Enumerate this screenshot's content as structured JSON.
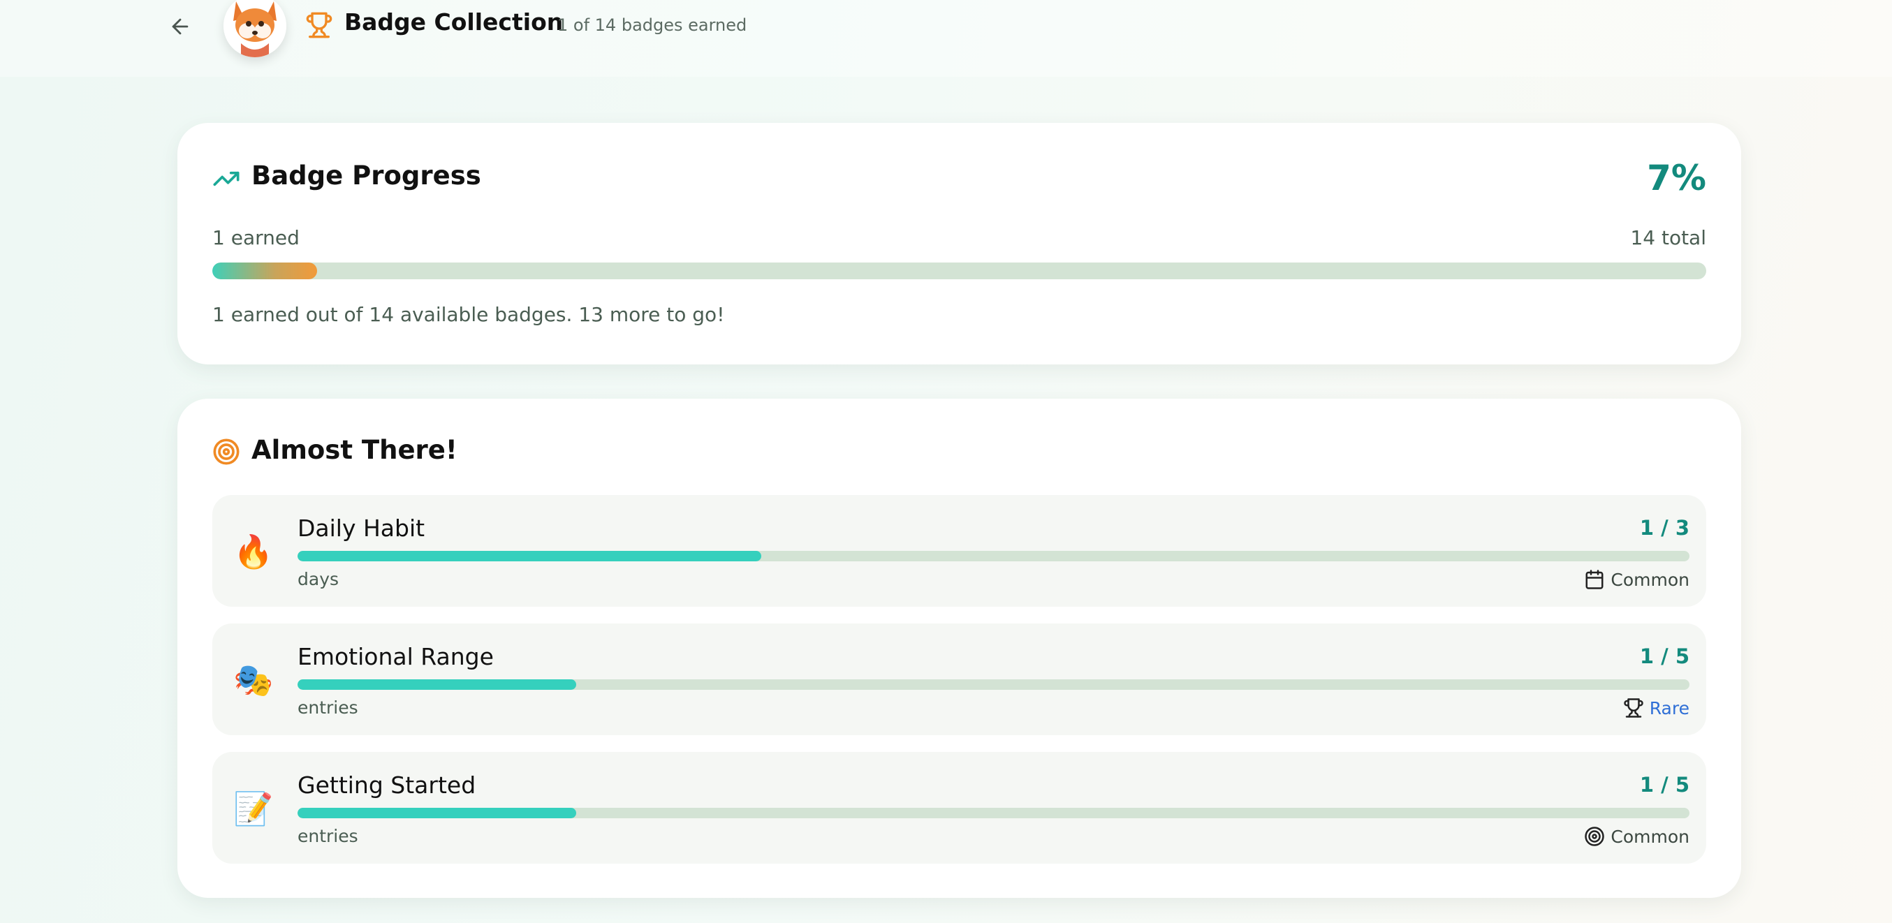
{
  "header": {
    "title": "Badge Collection",
    "subtitle": "1 of 14 badges earned",
    "back_icon": "arrow-left-icon",
    "trophy_icon": "trophy-icon",
    "avatar_icon": "fox-avatar"
  },
  "progress": {
    "title": "Badge Progress",
    "icon": "trending-up-icon",
    "percent": "7%",
    "earned_label": "1 earned",
    "total_label": "14 total",
    "fill_fraction": 0.07,
    "message": "1 earned out of 14 available badges. 13 more to go!"
  },
  "almost": {
    "title": "Almost There!",
    "icon": "target-icon",
    "badges": [
      {
        "name": "Daily Habit",
        "emoji": "🔥",
        "count": "1 / 3",
        "fraction": 0.333,
        "unit": "days",
        "rarity": "Common",
        "rarity_icon": "calendar-icon"
      },
      {
        "name": "Emotional Range",
        "emoji": "🎭",
        "count": "1 / 5",
        "fraction": 0.2,
        "unit": "entries",
        "rarity": "Rare",
        "rarity_icon": "trophy-icon"
      },
      {
        "name": "Getting Started",
        "emoji": "📝",
        "count": "1 / 5",
        "fraction": 0.2,
        "unit": "entries",
        "rarity": "Common",
        "rarity_icon": "target-icon"
      }
    ]
  },
  "colors": {
    "accent_teal": "#138a7d",
    "bar_teal": "#35d0bd",
    "accent_orange": "#f08a24",
    "rare_blue": "#2f6fd6",
    "track": "#d3e3d4"
  }
}
